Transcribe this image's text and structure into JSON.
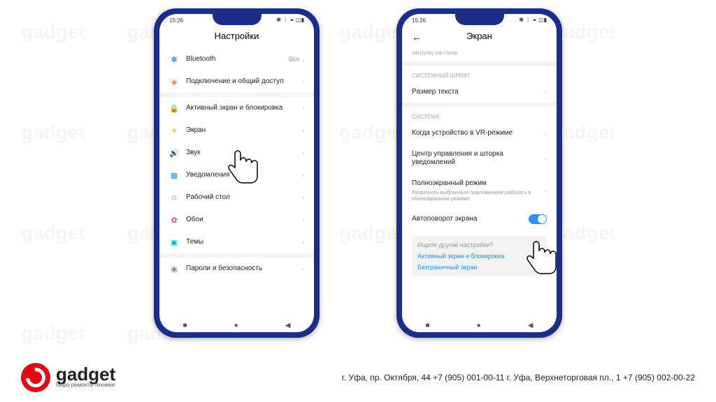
{
  "statusbar": {
    "time": "15:26",
    "icons_left": "▮ ⌀ ⎘ ···",
    "icons_right": "✽ ⋮ ⏶ ◫▮"
  },
  "phone1": {
    "title": "Настройки",
    "rows": [
      {
        "icon": "✽",
        "color": "#2890ff",
        "label": "Bluetooth",
        "value": "Вкл"
      },
      {
        "icon": "◈",
        "color": "#ff6b2c",
        "label": "Подключение и общий доступ"
      },
      {
        "sep": true
      },
      {
        "icon": "🔒",
        "color": "#ff3b30",
        "label": "Активный экран и блокировка"
      },
      {
        "icon": "☀",
        "color": "#ffb400",
        "label": "Экран"
      },
      {
        "icon": "🔊",
        "color": "#34c759",
        "label": "Звук"
      },
      {
        "icon": "▦",
        "color": "#2890ff",
        "label": "Уведомления"
      },
      {
        "icon": "⌂",
        "color": "#7b3ff2",
        "label": "Рабочий стол"
      },
      {
        "icon": "✿",
        "color": "#ff2d92",
        "label": "Обои"
      },
      {
        "icon": "▣",
        "color": "#00b8d4",
        "label": "Темы"
      },
      {
        "sep": true
      },
      {
        "icon": "◉",
        "color": "#888",
        "label": "Пароли и безопасность"
      }
    ]
  },
  "phone2": {
    "title": "Экран",
    "toptext": "нагрузку на глаза.",
    "sections": [
      {
        "header": "СИСТЕМНЫЙ ШРИФТ",
        "rows": [
          {
            "label": "Размер текста"
          }
        ]
      },
      {
        "header": "СИСТЕМА",
        "rows": [
          {
            "label": "Когда устройство в VR-режиме"
          },
          {
            "label": "Центр управления и шторка уведомлений"
          },
          {
            "label": "Полноэкранный режим",
            "sub": "Разрешить выбранным приложениям работать в полноэкранном режиме"
          },
          {
            "label": "Автоповорот экрана",
            "toggle": true
          }
        ]
      }
    ],
    "search": {
      "q": "Ищите другие настройки?",
      "links": [
        "Активный экран и блокировка",
        "Безграничный экран"
      ]
    }
  },
  "footer": {
    "brand": "gadget",
    "tagline": "бюро ремонта техники",
    "address": "г. Уфа, пр. Октября, 44   +7 (905) 001-00-11 г. Уфа, Верхнеторговая пл., 1   +7 (905) 002-00-22"
  }
}
